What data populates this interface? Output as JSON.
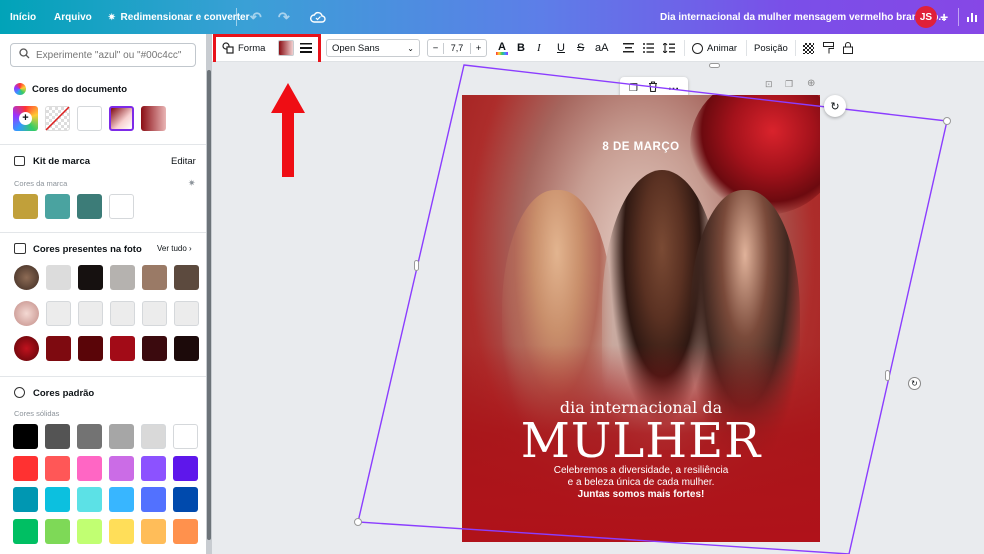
{
  "topbar": {
    "home": "Início",
    "file": "Arquivo",
    "resize": "Redimensionar e converter",
    "doc_title": "Dia internacional da mulher mensagem vermelho branco p...",
    "avatar": "JS"
  },
  "left": {
    "search_placeholder": "Experimente \"azul\" ou \"#00c4cc\"",
    "doc_colors_title": "Cores do documento",
    "brand_title": "Kit de marca",
    "brand_edit": "Editar",
    "brand_sub": "Cores da marca",
    "photo_title": "Cores presentes na foto",
    "photo_see_all": "Ver tudo",
    "default_title": "Cores padrão",
    "default_sub": "Cores sólidas",
    "doc_colors": [
      "#ffffff"
    ],
    "brand_colors": [
      "#c1a03a",
      "#4aa3a0",
      "#3c7c78",
      "#ffffff"
    ],
    "photo_row1": [
      "#dcdcdc",
      "#161110",
      "#b5b2af",
      "#9a7a66",
      "#5c4a3e"
    ],
    "photo_row2": [
      "#ececec",
      "#ececec",
      "#ececec",
      "#ececec",
      "#ececec"
    ],
    "photo_row3": [
      "#7e0a10",
      "#5a0508",
      "#a20b17",
      "#3b0a0e",
      "#1c0a0a"
    ],
    "default_colors": [
      [
        "#000000",
        "#545454",
        "#737373",
        "#a6a6a6",
        "#d9d9d9",
        "#ffffff"
      ],
      [
        "#ff3131",
        "#ff5757",
        "#ff66c4",
        "#cb6ce6",
        "#8c52ff",
        "#5e17eb"
      ],
      [
        "#0097b2",
        "#0cc0df",
        "#5ce1e6",
        "#38b6ff",
        "#5271ff",
        "#004aad"
      ],
      [
        "#00bf63",
        "#7ed957",
        "#c1ff72",
        "#ffde59",
        "#ffbd59",
        "#ff914d"
      ]
    ]
  },
  "toolbar": {
    "shape": "Forma",
    "font": "Open Sans",
    "font_size": "7,7",
    "animate": "Animar",
    "position": "Posição"
  },
  "poster": {
    "date_num": "8",
    "date_text": "DE MARÇO",
    "line1": "dia internacional da",
    "title": "MULHER",
    "body1": "Celebremos a diversidade, a resiliência",
    "body2": "e a beleza única de cada mulher.",
    "body3": "Juntas somos mais fortes!"
  }
}
